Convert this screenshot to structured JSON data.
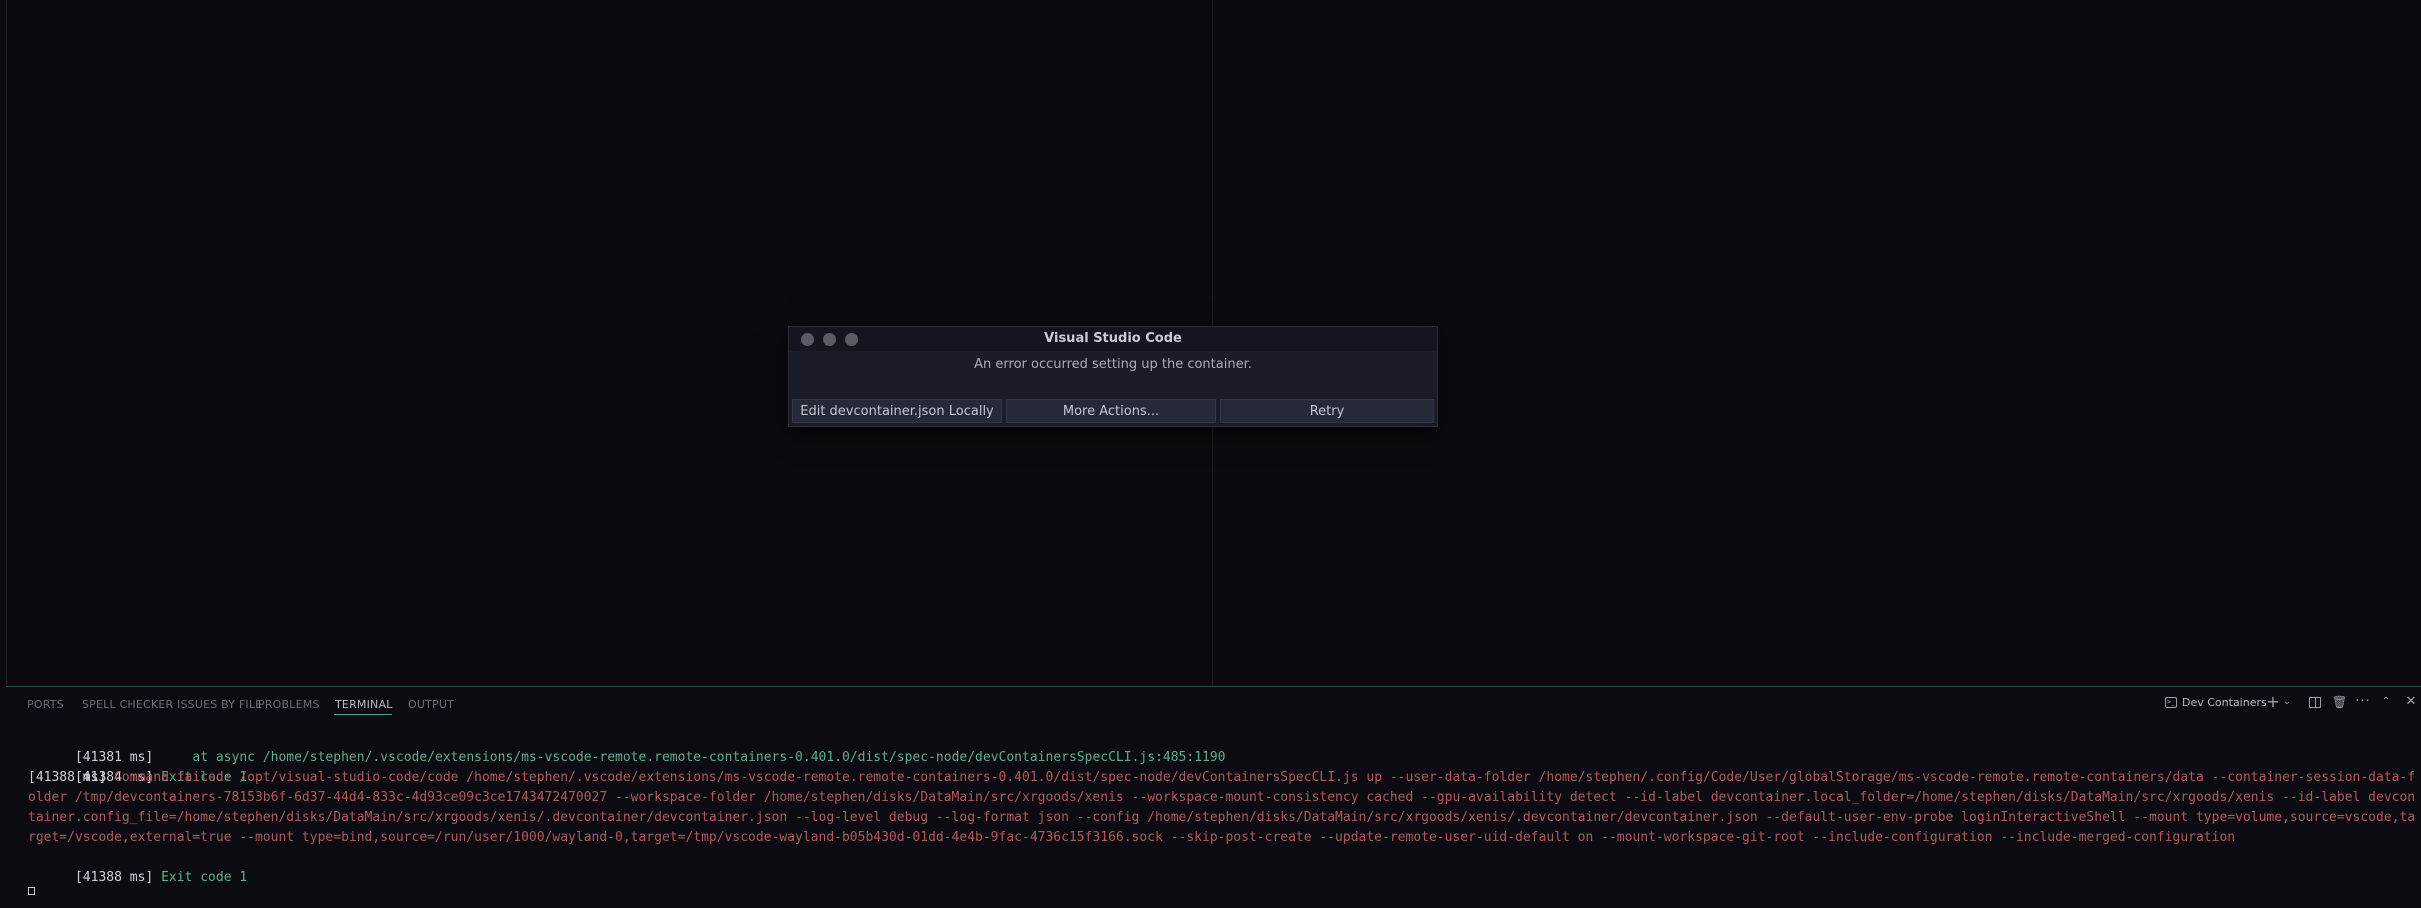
{
  "dialog": {
    "title": "Visual Studio Code",
    "message": "An error occurred setting up the container.",
    "buttons": [
      "Edit devcontainer.json Locally",
      "More Actions...",
      "Retry"
    ]
  },
  "panel": {
    "tabs": [
      "PORTS",
      "SPELL CHECKER ISSUES BY FILE",
      "PROBLEMS",
      "TERMINAL",
      "OUTPUT"
    ],
    "active_tab": "TERMINAL",
    "terminal_name": "Dev Containers",
    "toolbar_icons": [
      "terminal-icon",
      "plus-icon",
      "chevron-down-icon",
      "split-icon",
      "trash-icon",
      "more-icon",
      "chevron-up-icon",
      "close-icon"
    ]
  },
  "terminal": {
    "lines": [
      {
        "ts": "[41381 ms]",
        "text": "     at async /home/stephen/.vscode/extensions/ms-vscode-remote.remote-containers-0.401.0/dist/spec-node/devContainersSpecCLI.js:485:1190",
        "kind": "green"
      },
      {
        "ts": "[41384 ms]",
        "text": " Exit code 1",
        "kind": "green"
      },
      {
        "ts": "[41388 ms]",
        "text": " Command failed: /opt/visual-studio-code/code /home/stephen/.vscode/extensions/ms-vscode-remote.remote-containers-0.401.0/dist/spec-node/devContainersSpecCLI.js up --user-data-folder /home/stephen/.config/Code/User/globalStorage/ms-vscode-remote.remote-containers/data --container-session-data-folder /tmp/devcontainers-78153b6f-6d37-44d4-833c-4d93ce09c3ce1743472470027 --workspace-folder /home/stephen/disks/DataMain/src/xrgoods/xenis --workspace-mount-consistency cached --gpu-availability detect --id-label devcontainer.local_folder=/home/stephen/disks/DataMain/src/xrgoods/xenis --id-label devcontainer.config_file=/home/stephen/disks/DataMain/src/xrgoods/xenis/.devcontainer/devcontainer.json --log-level debug --log-format json --config /home/stephen/disks/DataMain/src/xrgoods/xenis/.devcontainer/devcontainer.json --default-user-env-probe loginInteractiveShell --mount type=volume,source=vscode,target=/vscode,external=true --mount type=bind,source=/run/user/1000/wayland-0,target=/tmp/vscode-wayland-b05b430d-01dd-4e4b-9fac-4736c15f3166.sock --skip-post-create --update-remote-user-uid-default on --mount-workspace-git-root --include-configuration --include-merged-configuration",
        "kind": "red"
      },
      {
        "ts": "[41388 ms]",
        "text": " Exit code 1",
        "kind": "green"
      }
    ]
  },
  "colors": {
    "background": "#0b0a10",
    "accent": "#4fa487",
    "terminal_green": "#5bb08a",
    "terminal_red": "#b25a5a"
  }
}
